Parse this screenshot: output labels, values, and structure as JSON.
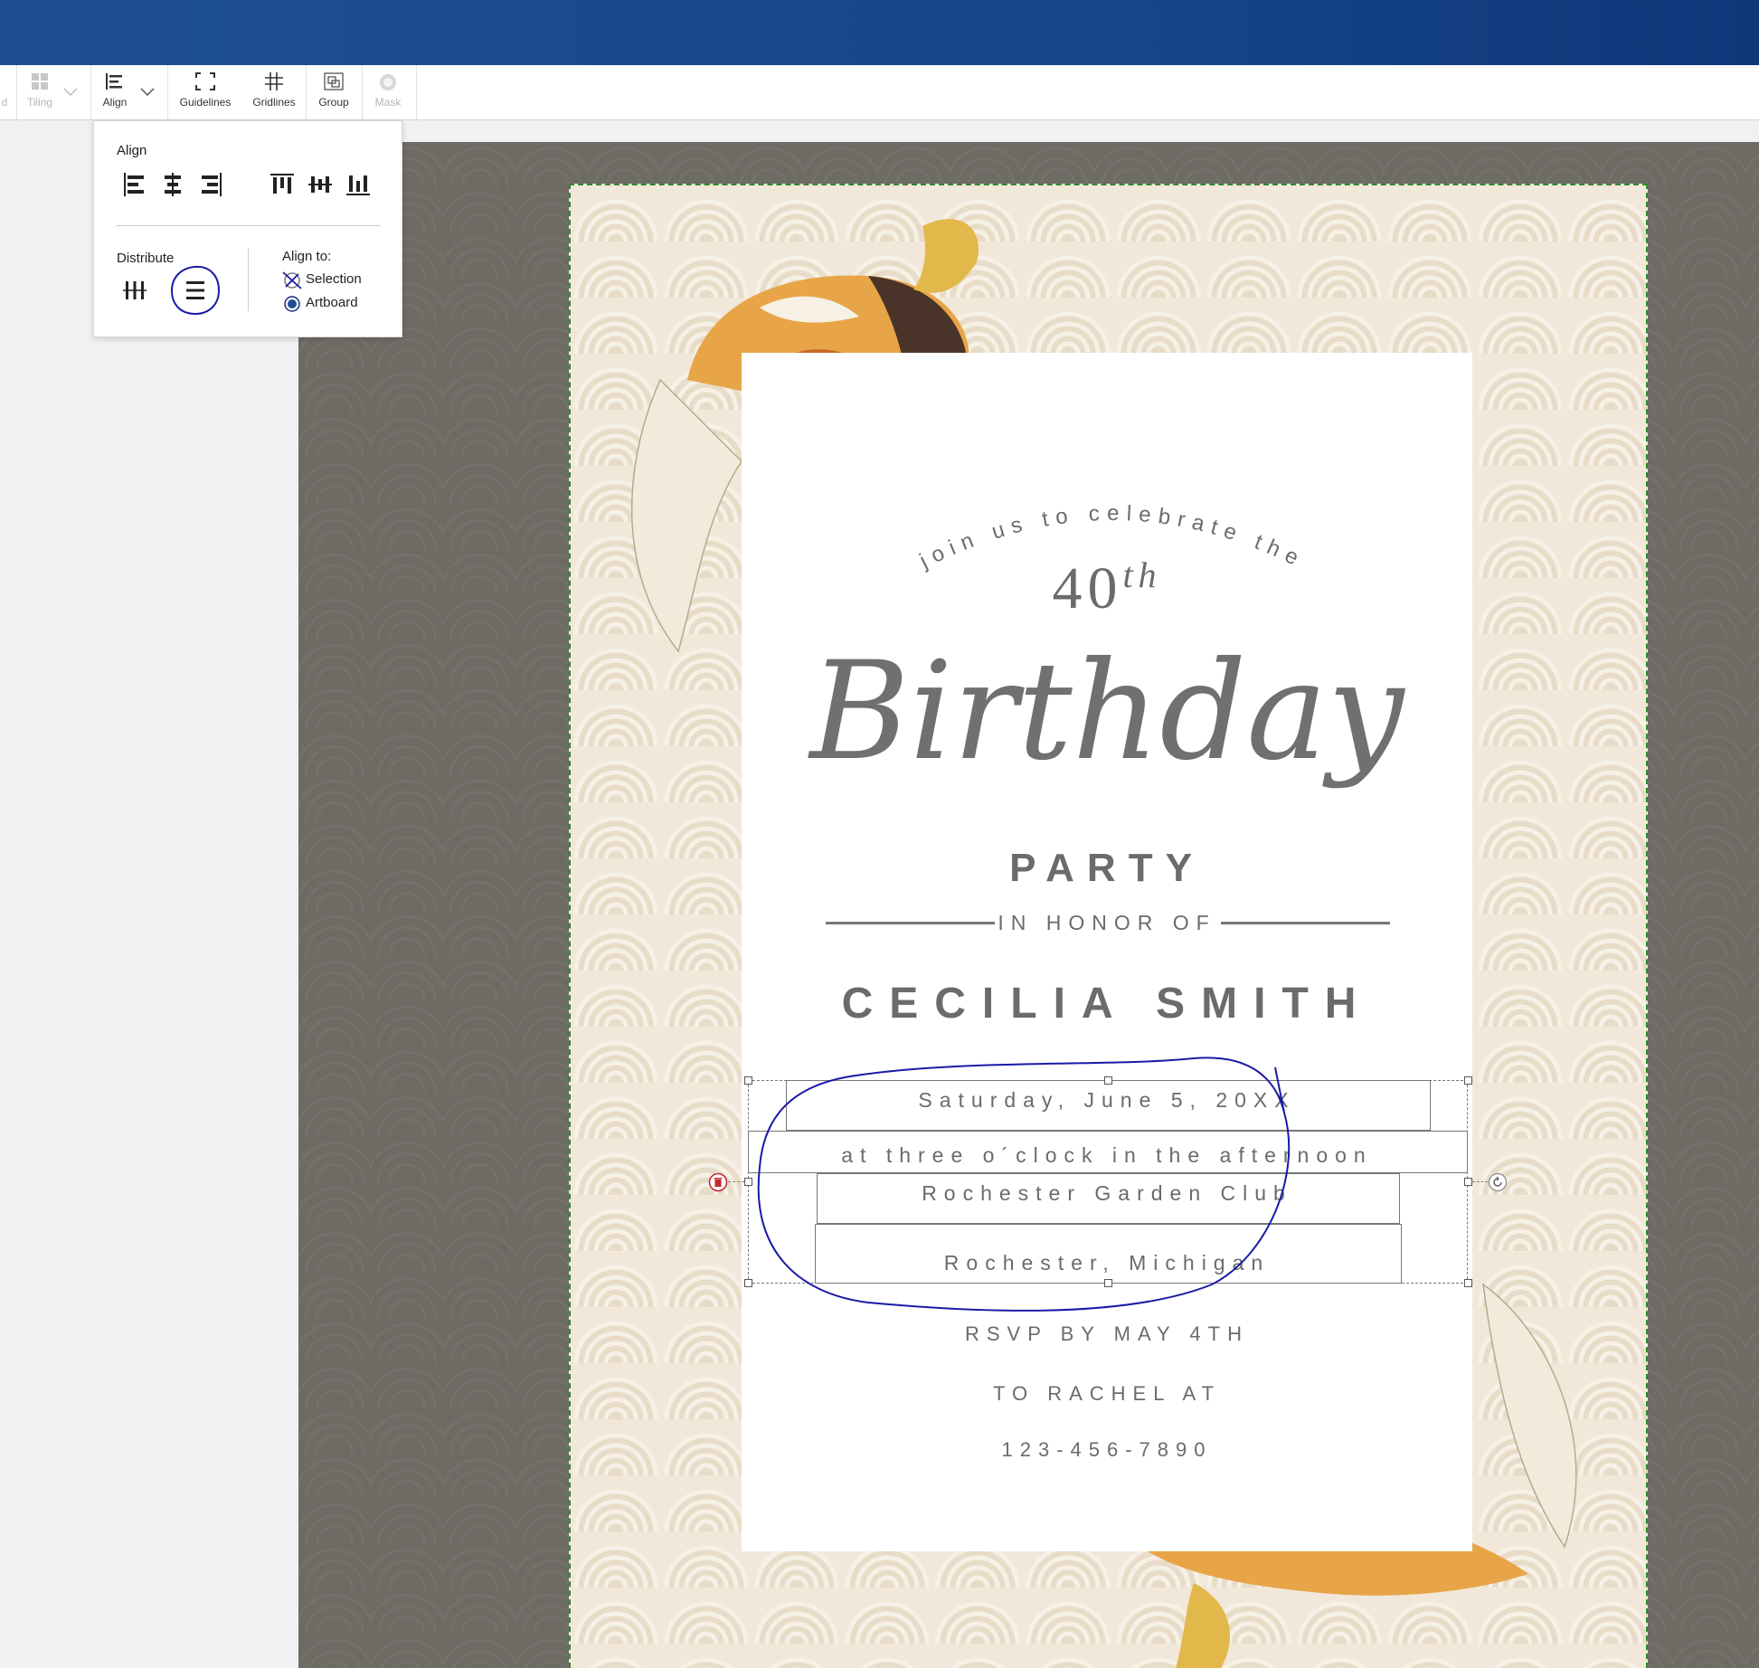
{
  "toolbar": {
    "partial_left": "d",
    "tiling": "Tiling",
    "align": "Align",
    "guidelines": "Guidelines",
    "gridlines": "Gridlines",
    "group": "Group",
    "mask": "Mask"
  },
  "align_panel": {
    "align_heading": "Align",
    "distribute_heading": "Distribute",
    "align_to_heading": "Align to:",
    "option_selection": "Selection",
    "option_artboard": "Artboard",
    "selected_option": "Artboard"
  },
  "invitation": {
    "arc_text": "join us to celebrate the",
    "number": "40",
    "number_suffix": "th",
    "script_title": "Birthday",
    "party": "PARTY",
    "in_honor_of": "IN HONOR OF",
    "name": "CECILIA SMITH",
    "date": "Saturday, June 5, 20XX",
    "time": "at three o´clock in the afternoon",
    "venue": "Rochester Garden Club",
    "city": "Rochester, Michigan",
    "rsvp": "RSVP BY MAY 4TH",
    "to": "TO RACHEL AT",
    "phone": "123-456-7890"
  },
  "icons": [
    "tiling-icon",
    "align-icon",
    "guidelines-icon",
    "gridlines-icon",
    "group-icon",
    "mask-icon",
    "align-left-icon",
    "align-center-icon",
    "align-right-icon",
    "align-top-icon",
    "align-middle-icon",
    "align-bottom-icon",
    "distribute-horizontal-icon",
    "distribute-vertical-icon",
    "delete-icon",
    "rotate-icon"
  ],
  "colors": {
    "titlebar": "#1e4f94",
    "canvas_bg": "#6e6a64",
    "artboard_bg": "#f1e8da",
    "text": "#6b6b6b",
    "annotation": "#1a1aa8"
  }
}
